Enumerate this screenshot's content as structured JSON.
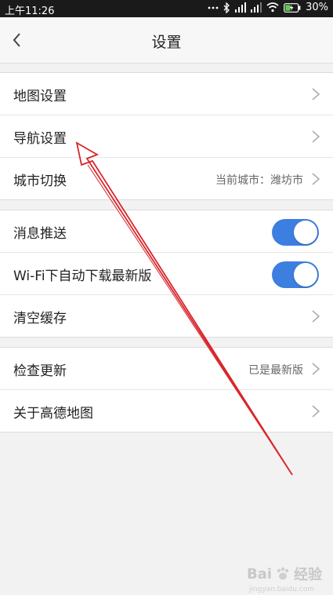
{
  "status_bar": {
    "time": "上午11:26",
    "battery_percent": "30%"
  },
  "header": {
    "title": "设置"
  },
  "groups": [
    {
      "rows": [
        {
          "label": "地图设置"
        },
        {
          "label": "导航设置"
        },
        {
          "label": "城市切换",
          "value": "当前城市：潍坊市"
        }
      ]
    },
    {
      "rows": [
        {
          "label": "消息推送",
          "toggle_on": true
        },
        {
          "label": "Wi-Fi下自动下载最新版",
          "toggle_on": true
        },
        {
          "label": "清空缓存"
        }
      ]
    },
    {
      "rows": [
        {
          "label": "检查更新",
          "value": "已是最新版"
        },
        {
          "label": "关于高德地图"
        }
      ]
    }
  ],
  "watermark": {
    "brand": "Bai",
    "brand_cn": "经验",
    "sub": "jingyan.baidu.com"
  },
  "colors": {
    "toggle_on": "#3d7fe0",
    "annotation_arrow": "#d9262c"
  }
}
